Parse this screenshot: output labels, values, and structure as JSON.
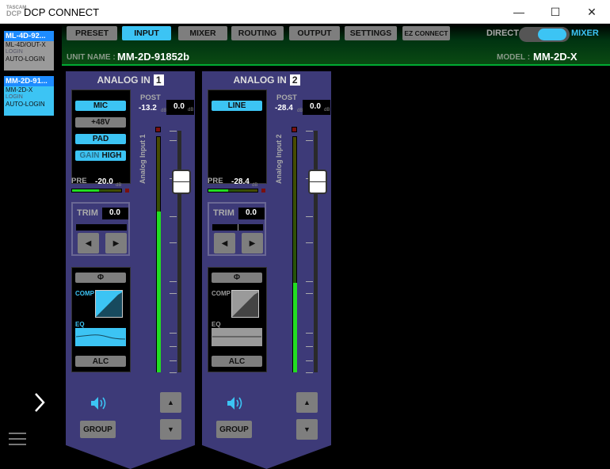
{
  "window": {
    "logo_top": "TASCAM",
    "logo_bottom": "DCP",
    "title": "DCP CONNECT",
    "minimize": "—",
    "maximize": "☐",
    "close": "✕"
  },
  "sidebar": {
    "devices": [
      {
        "name": "ML-4D-92...",
        "model": "ML-4D/OUT-X",
        "login": "LOGIN",
        "auto": "AUTO-LOGIN",
        "selected": false
      },
      {
        "name": "MM-2D-91...",
        "model": "MM-2D-X",
        "login": "LOGIN",
        "auto": "AUTO-LOGIN",
        "selected": true
      }
    ],
    "expand_icon": "chevron-right",
    "menu_icon": "hamburger"
  },
  "tabs": [
    "PRESET",
    "INPUT",
    "MIXER",
    "ROUTING",
    "OUTPUT",
    "SETTINGS",
    "EZ CONNECT"
  ],
  "active_tab": "INPUT",
  "mode": {
    "left": "DIRECT",
    "right": "MIXER",
    "selected": "MIXER"
  },
  "unit": {
    "label": "UNIT NAME :",
    "value": "MM-2D-91852b"
  },
  "model": {
    "label": "MODEL :",
    "value": "MM-2D-X"
  },
  "channels": [
    {
      "title": "ANALOG IN",
      "number": "1",
      "name": "Analog Input 1",
      "buttons": [
        {
          "label": "MIC",
          "on": true
        },
        {
          "label": "+48V",
          "on": false
        },
        {
          "label": "PAD",
          "on": true
        },
        {
          "label": "GAIN",
          "label2": "HIGH",
          "on": true
        }
      ],
      "post_label": "POST",
      "post_value": "-13.2",
      "fader_value": "0.0",
      "unit": "dB",
      "pre_label": "PRE",
      "pre_value": "-20.0",
      "pre_level": 0.55,
      "meter_level": 0.68,
      "fader_level": 0.79,
      "trim_label": "TRIM",
      "trim_value": "0.0",
      "phase": "Φ",
      "comp_label": "COMP",
      "eq_label": "EQ",
      "comp_eq_enabled": true,
      "alc": "ALC",
      "group": "GROUP",
      "up": "▲",
      "down": "▼",
      "left": "◀",
      "right": "▶"
    },
    {
      "title": "ANALOG IN",
      "number": "2",
      "name": "Analog Input 2",
      "buttons": [
        {
          "label": "LINE",
          "on": true
        }
      ],
      "post_label": "POST",
      "post_value": "-28.4",
      "fader_value": "0.0",
      "unit": "dB",
      "pre_label": "PRE",
      "pre_value": "-28.4",
      "pre_level": 0.4,
      "meter_level": 0.38,
      "fader_level": 0.79,
      "trim_label": "TRIM",
      "trim_value": "0.0",
      "phase": "Φ",
      "comp_label": "COMP",
      "eq_label": "EQ",
      "comp_eq_enabled": false,
      "alc": "ALC",
      "group": "GROUP",
      "up": "▲",
      "down": "▼",
      "left": "◀",
      "right": "▶"
    }
  ],
  "colors": {
    "accent": "#3cc4f4",
    "strip": "#3d3a78",
    "meter": "#22dd22"
  }
}
